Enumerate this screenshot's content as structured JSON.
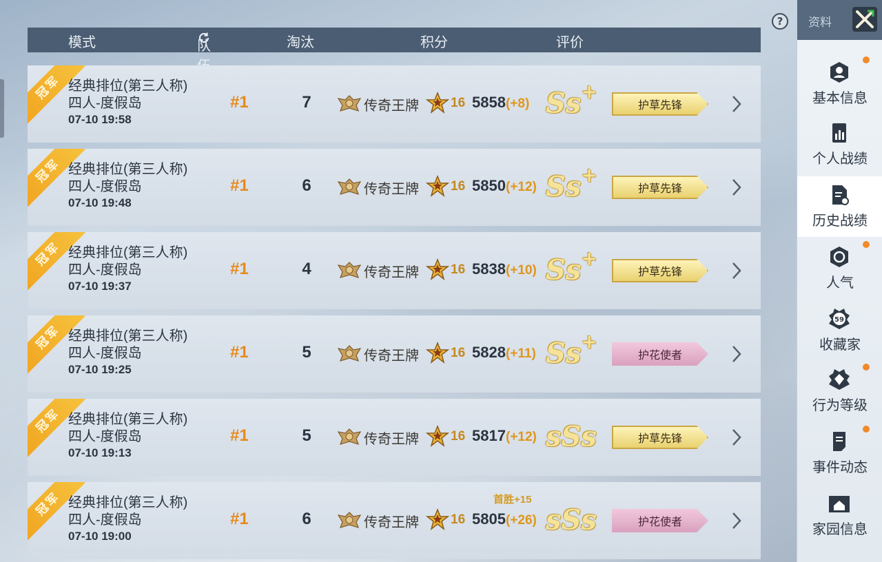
{
  "header": {
    "mode": "模式",
    "team_rank": "队伍排名",
    "kills": "淘汰",
    "score": "积分",
    "rating": "评价"
  },
  "help_icon": "?",
  "ribbon_text": "冠军",
  "matches": [
    {
      "mode": "经典排位(第三人称)",
      "map": "四人-度假岛",
      "time": "07-10 19:58",
      "rank": "#1",
      "kills": "7",
      "tier": "传奇王牌",
      "stars": "16",
      "score": "5858",
      "delta": "(+8)",
      "first_win": "",
      "grade": "Ss",
      "grade_plus": "+",
      "title": "护草先锋",
      "title_color": "gold"
    },
    {
      "mode": "经典排位(第三人称)",
      "map": "四人-度假岛",
      "time": "07-10 19:48",
      "rank": "#1",
      "kills": "6",
      "tier": "传奇王牌",
      "stars": "16",
      "score": "5850",
      "delta": "(+12)",
      "first_win": "",
      "grade": "Ss",
      "grade_plus": "+",
      "title": "护草先锋",
      "title_color": "gold"
    },
    {
      "mode": "经典排位(第三人称)",
      "map": "四人-度假岛",
      "time": "07-10 19:37",
      "rank": "#1",
      "kills": "4",
      "tier": "传奇王牌",
      "stars": "16",
      "score": "5838",
      "delta": "(+10)",
      "first_win": "",
      "grade": "Ss",
      "grade_plus": "+",
      "title": "护草先锋",
      "title_color": "gold"
    },
    {
      "mode": "经典排位(第三人称)",
      "map": "四人-度假岛",
      "time": "07-10 19:25",
      "rank": "#1",
      "kills": "5",
      "tier": "传奇王牌",
      "stars": "16",
      "score": "5828",
      "delta": "(+11)",
      "first_win": "",
      "grade": "Ss",
      "grade_plus": "+",
      "title": "护花使者",
      "title_color": "pink"
    },
    {
      "mode": "经典排位(第三人称)",
      "map": "四人-度假岛",
      "time": "07-10 19:13",
      "rank": "#1",
      "kills": "5",
      "tier": "传奇王牌",
      "stars": "16",
      "score": "5817",
      "delta": "(+12)",
      "first_win": "",
      "grade": "sSs",
      "grade_plus": "",
      "title": "护草先锋",
      "title_color": "gold"
    },
    {
      "mode": "经典排位(第三人称)",
      "map": "四人-度假岛",
      "time": "07-10 19:00",
      "rank": "#1",
      "kills": "6",
      "tier": "传奇王牌",
      "stars": "16",
      "score": "5805",
      "delta": "(+26)",
      "first_win": "首胜+15",
      "grade": "sSs",
      "grade_plus": "",
      "title": "护花使者",
      "title_color": "pink"
    }
  ],
  "sidebar": {
    "title": "资料",
    "items": [
      {
        "label": "基本信息",
        "icon": "profile-icon",
        "dot": true,
        "active": false
      },
      {
        "label": "个人战绩",
        "icon": "stats-chart-icon",
        "dot": false,
        "active": false
      },
      {
        "label": "历史战绩",
        "icon": "history-doc-icon",
        "dot": false,
        "active": true
      },
      {
        "label": "人气",
        "icon": "popularity-icon",
        "dot": true,
        "active": false
      },
      {
        "label": "收藏家",
        "icon": "collector-badge-icon",
        "dot": false,
        "active": false,
        "badge": "59"
      },
      {
        "label": "行为等级",
        "icon": "behavior-level-icon",
        "dot": true,
        "active": false
      },
      {
        "label": "事件动态",
        "icon": "events-doc-icon",
        "dot": true,
        "active": false
      },
      {
        "label": "家园信息",
        "icon": "home-icon",
        "dot": false,
        "active": false
      }
    ]
  },
  "colors": {
    "header_bg": "#4b5d72",
    "rank": "#e88a1a",
    "delta": "#e0961c",
    "ribbon": "#f1a521",
    "notify_dot": "#f08a2a"
  }
}
